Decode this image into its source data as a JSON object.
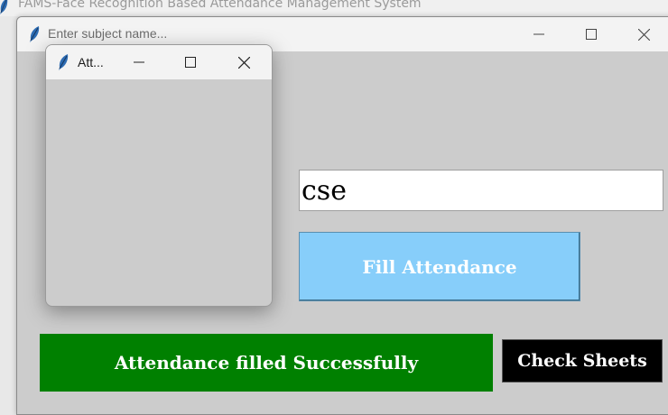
{
  "background_window": {
    "title": "FAMS-Face Recognition Based Attendance Management System"
  },
  "main_window": {
    "title": "Enter subject name...",
    "subject_input_value": "cse",
    "fill_button_label": "Fill Attendance",
    "status_message": "Attendance filled Successfully",
    "check_sheets_label": "Check Sheets"
  },
  "popup_window": {
    "title": "Att..."
  },
  "colors": {
    "window_bg": "#cccccc",
    "fill_button": "#87cefa",
    "status_bg": "#008000",
    "check_button": "#000000"
  },
  "icons": [
    "feather-icon",
    "minimize-icon",
    "maximize-icon",
    "close-icon"
  ]
}
